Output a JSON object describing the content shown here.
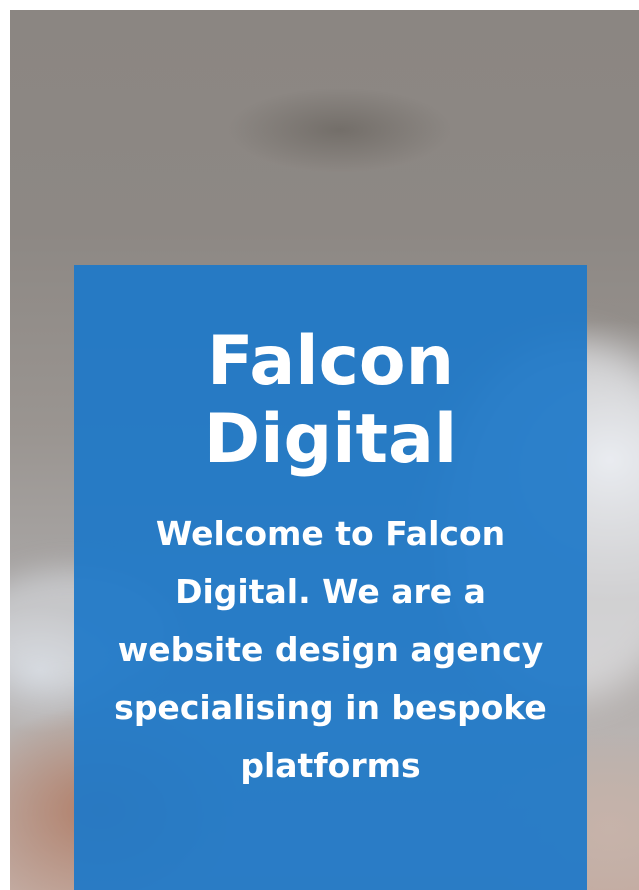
{
  "hero": {
    "title": "Falcon Digital",
    "intro": "Welcome to Falcon Digital. We are a website design agency specialising in bespoke platforms"
  },
  "colors": {
    "card_background": "#1e78c8",
    "text": "#ffffff"
  }
}
